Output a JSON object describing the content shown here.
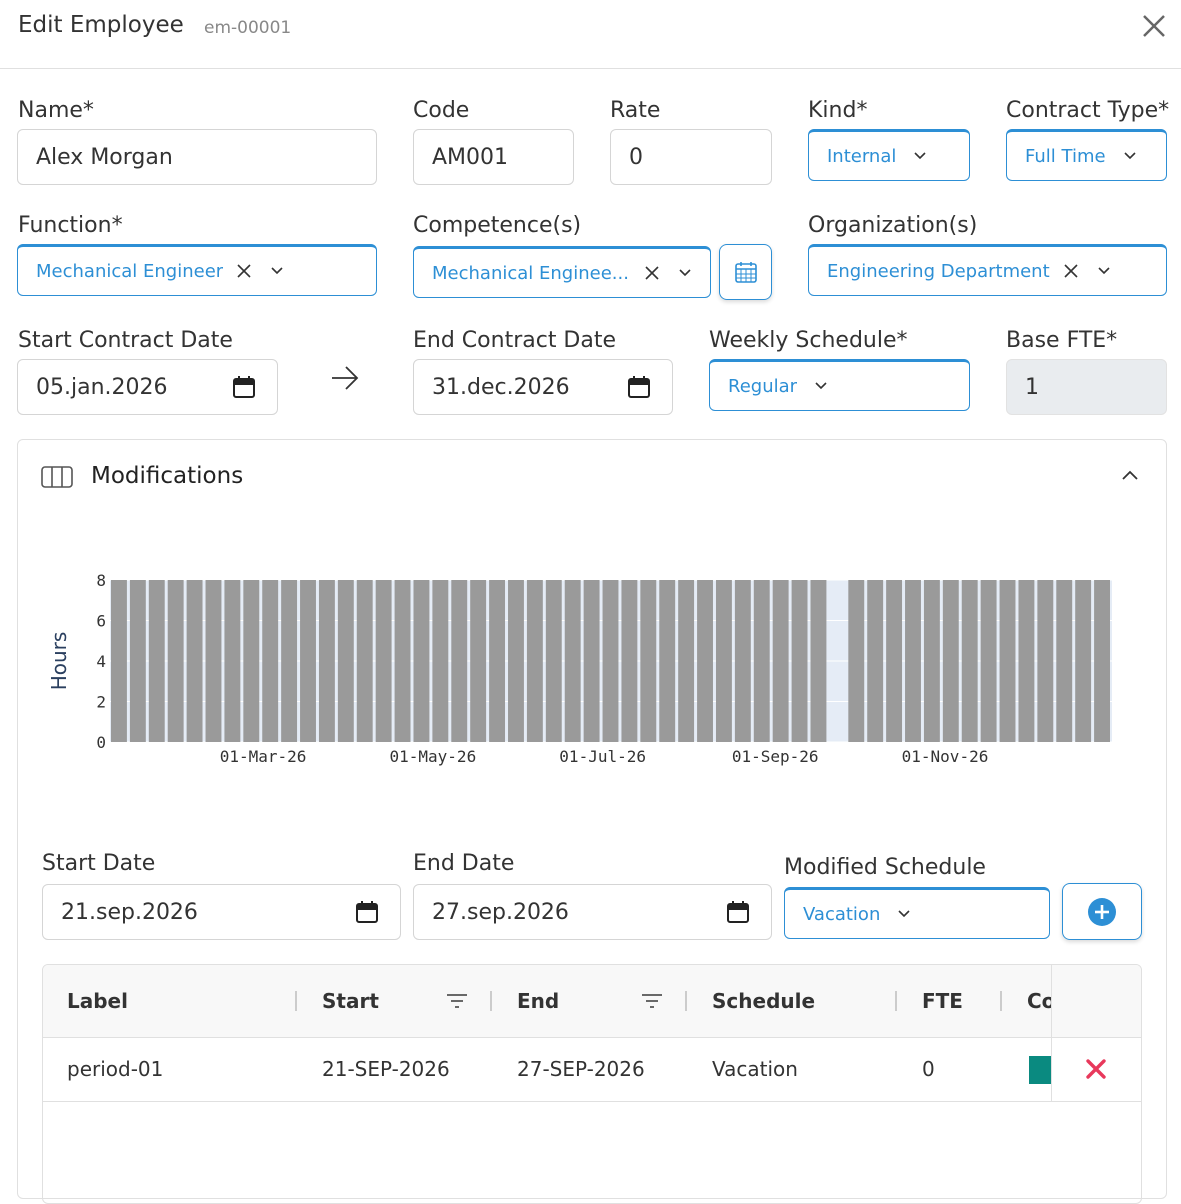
{
  "header": {
    "title": "Edit Employee",
    "subtitle": "em-00001"
  },
  "form": {
    "name": {
      "label": "Name*",
      "value": "Alex Morgan"
    },
    "code": {
      "label": "Code",
      "value": "AM001"
    },
    "rate": {
      "label": "Rate",
      "value": "0"
    },
    "kind": {
      "label": "Kind*",
      "value": "Internal"
    },
    "contract_type": {
      "label": "Contract Type*",
      "value": "Full Time"
    },
    "function": {
      "label": "Function*",
      "value": "Mechanical Engineer"
    },
    "competence": {
      "label": "Competence(s)",
      "value": "Mechanical Enginee..."
    },
    "organization": {
      "label": "Organization(s)",
      "value": "Engineering Department"
    },
    "start_contract": {
      "label": "Start Contract Date",
      "value": "05.jan.2026"
    },
    "end_contract": {
      "label": "End Contract Date",
      "value": "31.dec.2026"
    },
    "weekly_schedule": {
      "label": "Weekly Schedule*",
      "value": "Regular"
    },
    "base_fte": {
      "label": "Base FTE*",
      "value": "1"
    }
  },
  "modifications": {
    "title": "Modifications",
    "start_date": {
      "label": "Start Date",
      "value": "21.sep.2026"
    },
    "end_date": {
      "label": "End Date",
      "value": "27.sep.2026"
    },
    "modified_schedule": {
      "label": "Modified Schedule",
      "value": "Vacation"
    },
    "table": {
      "headers": [
        "Label",
        "Start",
        "End",
        "Schedule",
        "FTE",
        "Co"
      ],
      "rows": [
        {
          "label": "period-01",
          "start": "21-SEP-2026",
          "end": "27-SEP-2026",
          "schedule": "Vacation",
          "fte": "0",
          "color": "#0a8a80"
        }
      ]
    }
  },
  "colors": {
    "accent": "#2d8fd5",
    "bar": "#9a9a9a",
    "plot_bg": "#e5ecf6",
    "delete": "#e8385b"
  },
  "chart_data": {
    "type": "bar",
    "ylabel": "Hours",
    "ylim": [
      0,
      8
    ],
    "yticks": [
      "0",
      "2",
      "4",
      "6",
      "8"
    ],
    "xticks": [
      "01-Mar-26",
      "01-May-26",
      "01-Jul-26",
      "01-Sep-26",
      "01-Nov-26"
    ],
    "x_start": "2026-01-05",
    "x_end": "2026-12-31",
    "bar_unit": "week",
    "series": [
      {
        "values": [
          8,
          8,
          8,
          8,
          8,
          8,
          8,
          8,
          8,
          8,
          8,
          8,
          8,
          8,
          8,
          8,
          8,
          8,
          8,
          8,
          8,
          8,
          8,
          8,
          8,
          8,
          8,
          8,
          8,
          8,
          8,
          8,
          8,
          8,
          8,
          8,
          8,
          8,
          0,
          8,
          8,
          8,
          8,
          8,
          8,
          8,
          8,
          8,
          8,
          8,
          8,
          8,
          8
        ]
      }
    ]
  }
}
